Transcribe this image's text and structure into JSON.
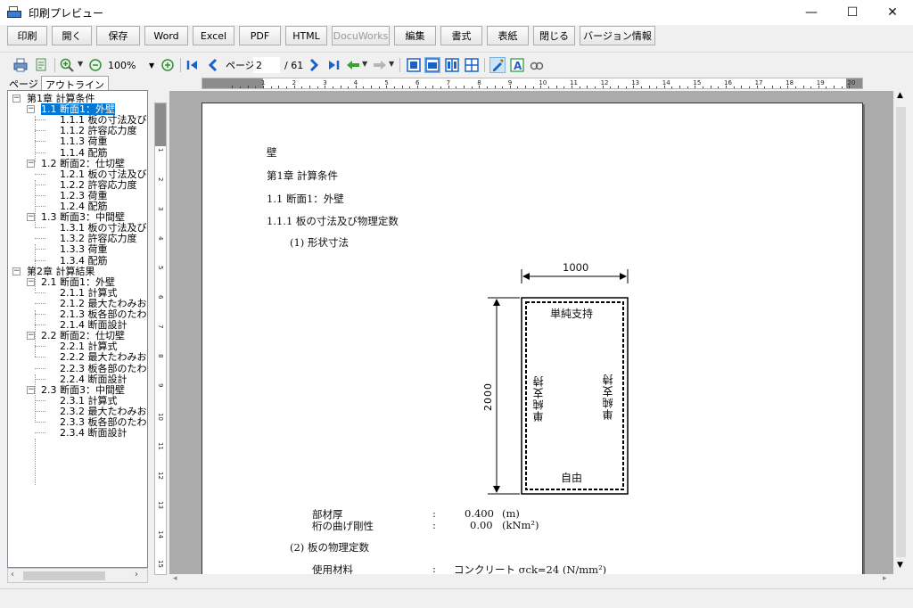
{
  "window": {
    "title": "印刷プレビュー",
    "minimize": "—",
    "maximize": "☐",
    "close": "✕"
  },
  "buttons": [
    "印刷",
    "開く",
    "保存",
    "Word",
    "Excel",
    "PDF",
    "HTML",
    "DocuWorks",
    "編集",
    "書式",
    "表紙",
    "閉じる",
    "バージョン情報"
  ],
  "buttons_disabled": [
    "DocuWorks"
  ],
  "toolbar": {
    "zoom": "100%",
    "page_label": "ページ",
    "page_value": "2",
    "page_total": "/ 61"
  },
  "sidebar": {
    "tabs": [
      "ページ",
      "アウトライン"
    ],
    "active_tab": "アウトライン",
    "tree": [
      {
        "level": 0,
        "label": "第1章 計算条件",
        "expanded": true
      },
      {
        "level": 1,
        "label": "1.1 断面1：外壁",
        "expanded": true,
        "selected": true
      },
      {
        "level": 2,
        "label": "1.1.1 板の寸法及び物"
      },
      {
        "level": 2,
        "label": "1.1.2 許容応力度"
      },
      {
        "level": 2,
        "label": "1.1.3 荷重"
      },
      {
        "level": 2,
        "label": "1.1.4 配筋"
      },
      {
        "level": 1,
        "label": "1.2 断面2：仕切壁",
        "expanded": true
      },
      {
        "level": 2,
        "label": "1.2.1 板の寸法及び物"
      },
      {
        "level": 2,
        "label": "1.2.2 許容応力度"
      },
      {
        "level": 2,
        "label": "1.2.3 荷重"
      },
      {
        "level": 2,
        "label": "1.2.4 配筋"
      },
      {
        "level": 1,
        "label": "1.3 断面3：中間壁",
        "expanded": true
      },
      {
        "level": 2,
        "label": "1.3.1 板の寸法及び物"
      },
      {
        "level": 2,
        "label": "1.3.2 許容応力度"
      },
      {
        "level": 2,
        "label": "1.3.3 荷重"
      },
      {
        "level": 2,
        "label": "1.3.4 配筋"
      },
      {
        "level": 0,
        "label": "第2章 計算結果",
        "expanded": true
      },
      {
        "level": 1,
        "label": "2.1 断面1：外壁",
        "expanded": true
      },
      {
        "level": 2,
        "label": "2.1.1 計算式"
      },
      {
        "level": 2,
        "label": "2.1.2 最大たわみおよ"
      },
      {
        "level": 2,
        "label": "2.1.3 板各部のたわみ"
      },
      {
        "level": 2,
        "label": "2.1.4 断面設計"
      },
      {
        "level": 1,
        "label": "2.2 断面2：仕切壁",
        "expanded": true
      },
      {
        "level": 2,
        "label": "2.2.1 計算式"
      },
      {
        "level": 2,
        "label": "2.2.2 最大たわみおよ"
      },
      {
        "level": 2,
        "label": "2.2.3 板各部のたわみ"
      },
      {
        "level": 2,
        "label": "2.2.4 断面設計"
      },
      {
        "level": 1,
        "label": "2.3 断面3：中間壁",
        "expanded": true
      },
      {
        "level": 2,
        "label": "2.3.1 計算式"
      },
      {
        "level": 2,
        "label": "2.3.2 最大たわみおよ"
      },
      {
        "level": 2,
        "label": "2.3.3 板各部のたわみ"
      },
      {
        "level": 2,
        "label": "2.3.4 断面設計"
      }
    ]
  },
  "ruler_h": [
    "1",
    "2",
    "3",
    "4",
    "5",
    "6",
    "7",
    "8",
    "9",
    "10",
    "11",
    "12",
    "13",
    "14",
    "15",
    "16",
    "17",
    "18",
    "19",
    "20"
  ],
  "ruler_v": [
    "1",
    "2",
    "3",
    "4",
    "5",
    "6",
    "7",
    "8",
    "9",
    "10",
    "11",
    "12",
    "13",
    "14",
    "15",
    "16"
  ],
  "document": {
    "heading_wall": "壁",
    "chapter": "第1章 計算条件",
    "section": "1.1 断面1：外壁",
    "subsection": "1.1.1 板の寸法及び物理定数",
    "item1": "(1) 形状寸法",
    "figure": {
      "width_label": "1000",
      "height_label": "2000",
      "top_edge": "単純支持",
      "left_edge": "単純支持",
      "right_edge": "単純支持",
      "bottom_edge": "自由"
    },
    "props": [
      {
        "name": "部材厚",
        "sep": ":",
        "value": "0.400",
        "unit": "(m)"
      },
      {
        "name": "桁の曲げ剛性",
        "sep": ":",
        "value": "0.00",
        "unit": "(kNm²)"
      }
    ],
    "item2": "(2) 板の物理定数",
    "material": {
      "name": "使用材料",
      "sep": ":",
      "value": "コンクリート σck=24 (N/mm²)"
    }
  }
}
